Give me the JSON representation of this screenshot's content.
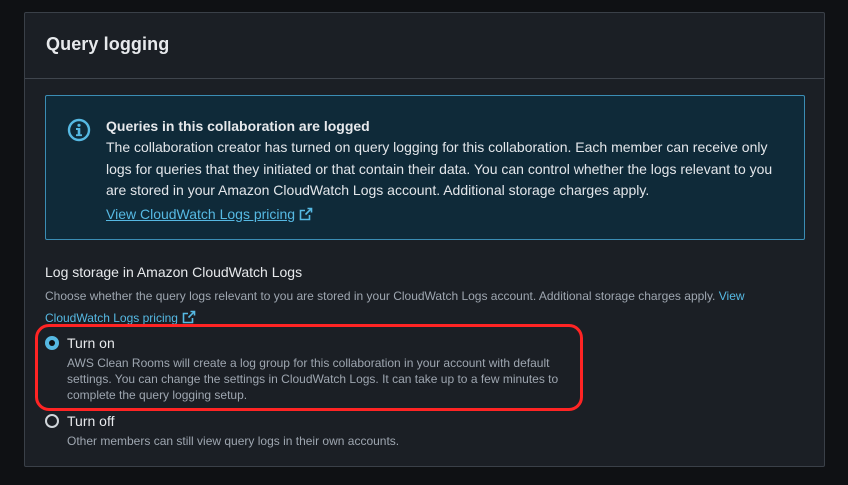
{
  "panel": {
    "title": "Query logging"
  },
  "info": {
    "icon": "info-icon",
    "title": "Queries in this collaboration are logged",
    "body": "The collaboration creator has turned on query logging for this collaboration. Each member can receive only logs for queries that they initiated or that contain their data. You can control whether the logs relevant to you are stored in your Amazon CloudWatch Logs account. Additional storage charges apply.",
    "link_label": "View CloudWatch Logs pricing",
    "link_icon": "external-link-icon",
    "accent_color": "#3b8db4",
    "background_color": "#0f2a39"
  },
  "log_storage": {
    "label": "Log storage in Amazon CloudWatch Logs",
    "description": "Choose whether the query logs relevant to you are stored in your CloudWatch Logs account. Additional storage charges apply.",
    "link_part1": "View",
    "link_part2": "CloudWatch Logs pricing",
    "link_icon": "external-link-icon",
    "options": [
      {
        "label": "Turn on",
        "description": "AWS Clean Rooms will create a log group for this collaboration in your account with default settings. You can change the settings in CloudWatch Logs. It can take up to a few minutes to complete the query logging setup.",
        "selected": true
      },
      {
        "label": "Turn off",
        "description": "Other members can still view query logs in their own accounts.",
        "selected": false
      }
    ],
    "link_color": "#56b9e3"
  },
  "annotation": {
    "highlight_color": "#ff2424"
  }
}
